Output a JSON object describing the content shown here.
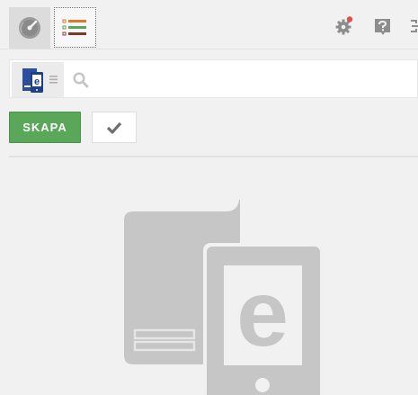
{
  "toolbar": {
    "dashboard_icon": "speedometer-icon",
    "list_icon": "colored-list-icon",
    "settings_icon": "gear-icon",
    "settings_has_notification": true,
    "help_icon": "question-icon",
    "exit_icon": "exit-icon"
  },
  "search": {
    "app_icon": "ebook-app-icon",
    "menu_icon": "hamburger-icon",
    "search_icon": "search-icon",
    "placeholder": ""
  },
  "actions": {
    "create_label": "SKAPA",
    "confirm_icon": "checkmark-icon"
  },
  "empty_state": {
    "illustration": "ebook-illustration",
    "letter": "e"
  },
  "colors": {
    "create_button": "#5aa75a",
    "notification_dot": "#d9534f",
    "app_icon_blue": "#2b4f9e",
    "list_orange": "#d9792b",
    "list_green": "#5aa75a",
    "list_red": "#9b3b3b"
  }
}
